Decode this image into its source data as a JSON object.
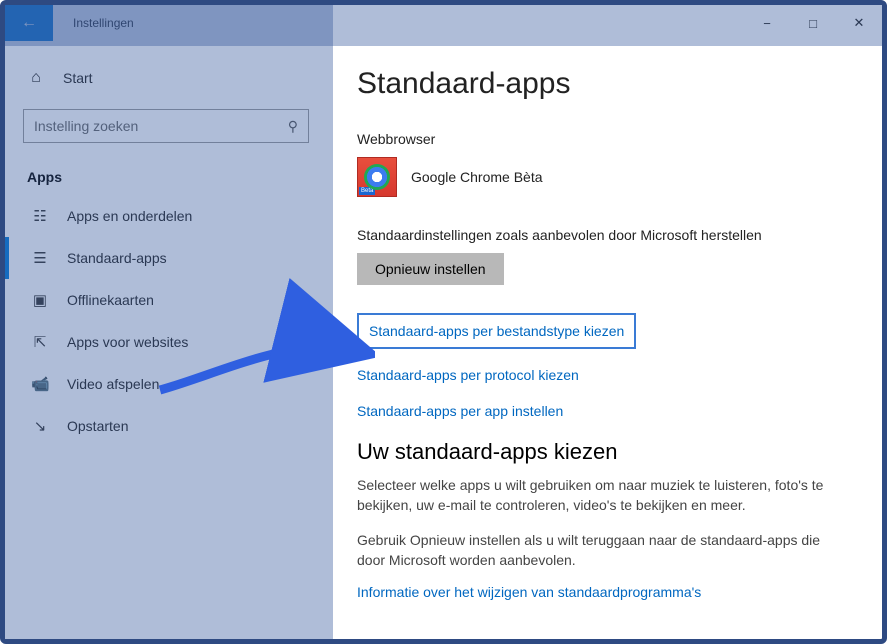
{
  "titlebar": {
    "title": "Instellingen"
  },
  "sidebar": {
    "home": "Start",
    "search_placeholder": "Instelling zoeken",
    "category": "Apps",
    "items": [
      {
        "label": "Apps en onderdelen"
      },
      {
        "label": "Standaard-apps"
      },
      {
        "label": "Offlinekaarten"
      },
      {
        "label": "Apps voor websites"
      },
      {
        "label": "Video afspelen"
      },
      {
        "label": "Opstarten"
      }
    ]
  },
  "main": {
    "heading": "Standaard-apps",
    "browser_label": "Webbrowser",
    "browser_app": "Google Chrome Bèta",
    "restore_label": "Standaardinstellingen zoals aanbevolen door Microsoft herstellen",
    "reset_button": "Opnieuw instellen",
    "link_filetype": "Standaard-apps per bestandstype kiezen",
    "link_protocol": "Standaard-apps per protocol kiezen",
    "link_perapp": "Standaard-apps per app instellen",
    "subheading": "Uw standaard-apps kiezen",
    "para1": "Selecteer welke apps u wilt gebruiken om naar muziek te luisteren, foto's te bekijken, uw e-mail te controleren, video's te bekijken en meer.",
    "para2": "Gebruik Opnieuw instellen als u wilt teruggaan naar de standaard-apps die door Microsoft worden aanbevolen.",
    "info_link": "Informatie over het wijzigen van standaardprogramma's"
  }
}
